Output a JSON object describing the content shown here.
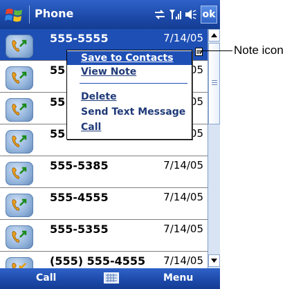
{
  "titlebar": {
    "app_title": "Phone",
    "ok_label": "ok",
    "icons": [
      "windows-flag-icon",
      "connectivity-icon",
      "signal-icon",
      "volume-icon"
    ]
  },
  "calls": [
    {
      "number": "555-5555",
      "date": "7/14/05",
      "selected": true,
      "has_note": true,
      "icon": "outgoing-call-icon"
    },
    {
      "number": "55",
      "date": "05",
      "icon": "outgoing-call-icon"
    },
    {
      "number": "55",
      "date": "05",
      "icon": "outgoing-call-icon"
    },
    {
      "number": "55",
      "date": "05",
      "icon": "outgoing-call-icon"
    },
    {
      "number": "555-5385",
      "date": "7/14/05",
      "icon": "outgoing-call-icon"
    },
    {
      "number": "555-4555",
      "date": "7/14/05",
      "icon": "outgoing-call-icon"
    },
    {
      "number": "555-5355",
      "date": "7/14/05",
      "icon": "outgoing-call-icon"
    },
    {
      "number": "(555) 555-4555",
      "date": "7/14/05",
      "icon": "incoming-call-icon"
    }
  ],
  "context_menu": {
    "items": [
      {
        "label": "Save to Contacts",
        "highlighted": true
      },
      {
        "label": "View Note"
      },
      {
        "label": "Delete"
      },
      {
        "label": "Send Text Message"
      },
      {
        "label": "Call"
      }
    ]
  },
  "menubar": {
    "left_label": "Call",
    "right_label": "Menu",
    "center_icon": "keyboard-icon"
  },
  "callout": {
    "label": "Note icon"
  },
  "colors": {
    "titlebar": "#1c49a8",
    "selection": "#1e4fb5",
    "menu_text": "#1f3a78"
  }
}
